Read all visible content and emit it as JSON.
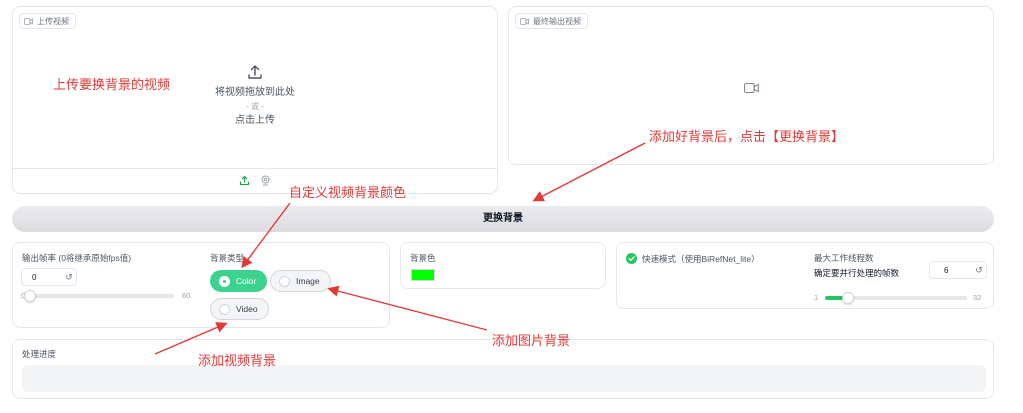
{
  "upload_panel": {
    "label": "上传视频",
    "drop_text": "将视频拖放到此处",
    "or_text": "- 或 -",
    "click_text": "点击上传"
  },
  "output_panel": {
    "label": "最终输出视频"
  },
  "run_button": {
    "label": "更换背景"
  },
  "settings": {
    "fps_label": "输出帧率 (0将继承原始fps值)",
    "fps_value": "0",
    "fps_min": "0",
    "fps_max": "60",
    "fps_slider_value": 0,
    "bg_type_label": "背景类型",
    "bg_options": [
      "Color",
      "Image",
      "Video"
    ],
    "bg_selected": "Color"
  },
  "bg_color": {
    "label": "背景色",
    "value": "#00ff00"
  },
  "fast_mode": {
    "label": "快速模式（使用BiRefNet_lite）",
    "checked": true,
    "workers_label": "最大工作线程数",
    "workers_desc": "确定要并行处理的帧数",
    "workers_value": "6",
    "workers_min": "1",
    "workers_max": "32",
    "workers_slider_value": 6
  },
  "progress": {
    "label": "处理进度"
  },
  "annotations": {
    "upload_hint": "上传要换背景的视频",
    "replace_hint": "添加好背景后，点击【更换背景】",
    "color_hint": "自定义视频背景颜色",
    "image_hint": "添加图片背景",
    "video_hint": "添加视频背景"
  },
  "colors": {
    "accent": "#3dd38f",
    "annotation": "#e53935"
  }
}
